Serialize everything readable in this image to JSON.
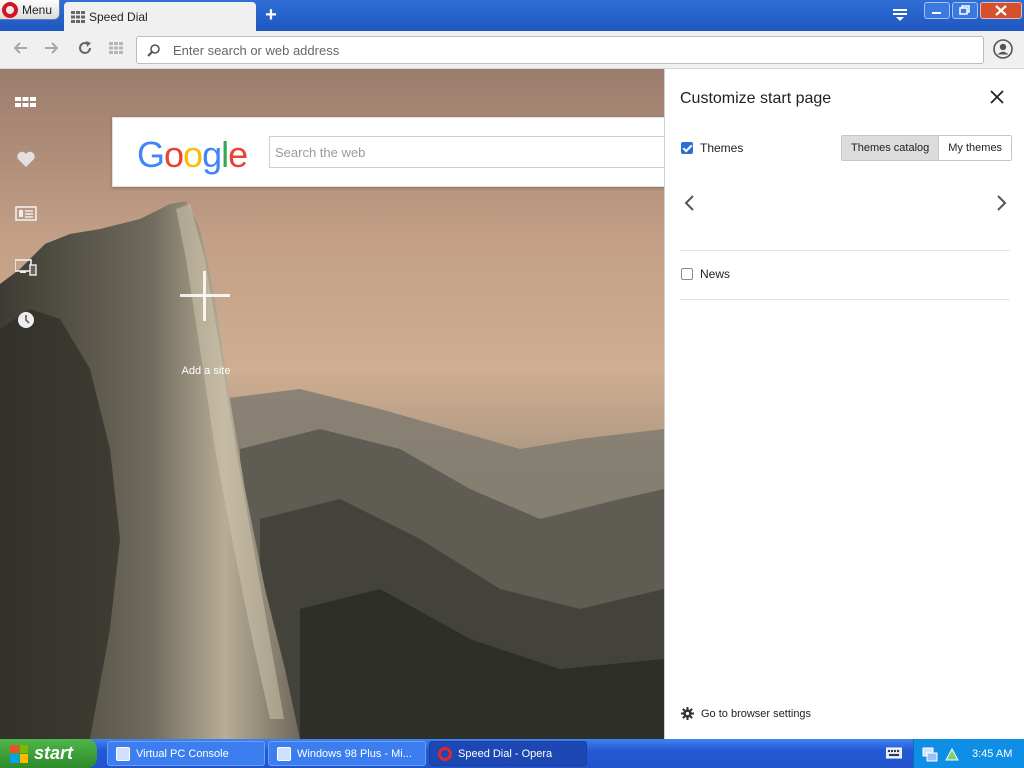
{
  "window": {
    "menu_label": "Menu",
    "tab_title": "Speed Dial",
    "new_tab": "+"
  },
  "addressbar": {
    "placeholder": "Enter search or web address"
  },
  "speed_dial": {
    "google_logo": "Google",
    "search_placeholder": "Search the web",
    "add_site_label": "Add a site"
  },
  "customize_panel": {
    "title": "Customize start page",
    "themes_label": "Themes",
    "themes_checked": true,
    "themes_catalog": "Themes catalog",
    "my_themes": "My themes",
    "news_label": "News",
    "news_checked": false,
    "settings_link": "Go to browser settings"
  },
  "taskbar": {
    "start": "start",
    "tasks": [
      {
        "label": "Virtual PC Console",
        "active": false
      },
      {
        "label": "Windows 98 Plus - Mi...",
        "active": false
      },
      {
        "label": "Speed Dial - Opera",
        "active": true
      }
    ],
    "clock": "3:45 AM"
  },
  "colors": {
    "titlebar": "#1f56c0",
    "opera_red": "#d4151f",
    "checkbox_blue": "#2b6fd3",
    "start_green": "#2d8a2a"
  }
}
